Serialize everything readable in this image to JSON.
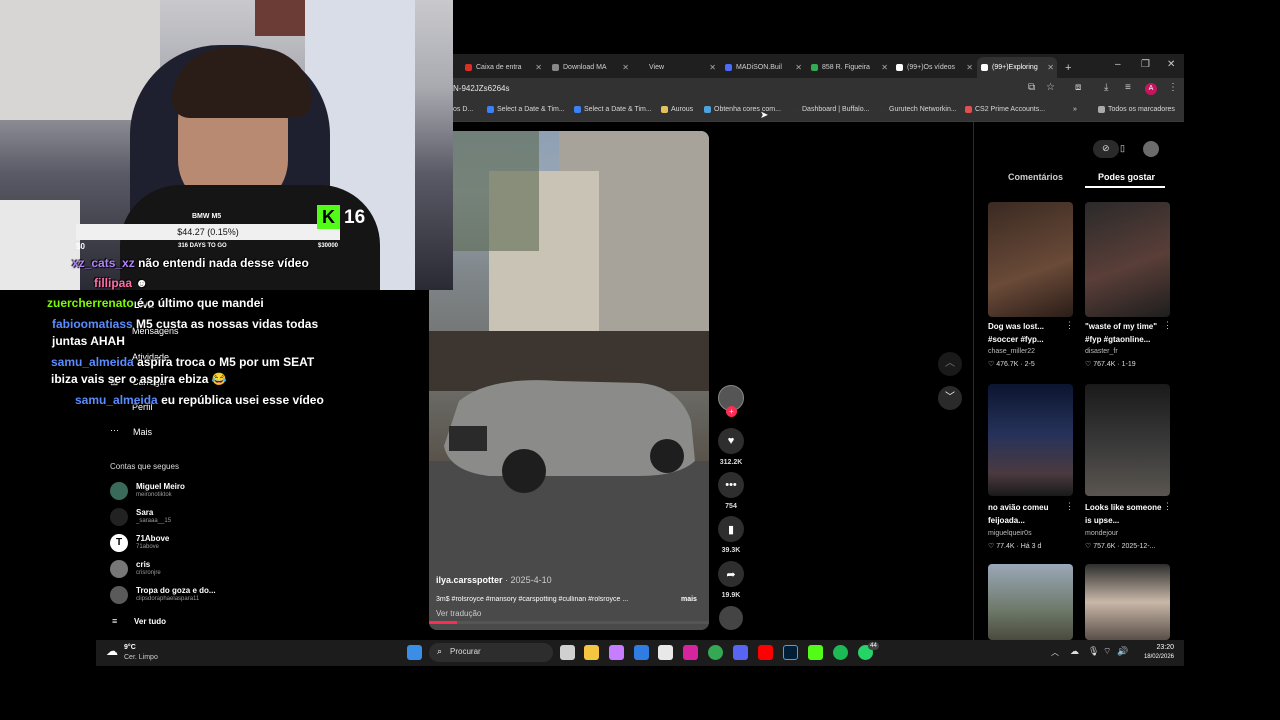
{
  "browser": {
    "tabs": [
      {
        "label": "Caixa de entra",
        "color": "#d93025"
      },
      {
        "label": "Download MA",
        "color": "#888888"
      },
      {
        "label": "View",
        "color": "#888888"
      },
      {
        "label": "MADiSON.Buil",
        "color": "#4a6cf7"
      },
      {
        "label": "858 R. Figueira",
        "color": "#34a853"
      },
      {
        "label": "(99+)Os vídeos",
        "color": "#ffffff"
      },
      {
        "label": "(99+)Exploring",
        "color": "#ffffff"
      }
    ],
    "url": "N-942JZs6264s",
    "bookmarks": [
      {
        "label": "os D...",
        "color": "#888888"
      },
      {
        "label": "Select a Date & Tim...",
        "color": "#3b82f6"
      },
      {
        "label": "Select a Date & Tim...",
        "color": "#3b82f6"
      },
      {
        "label": "Aurous",
        "color": "#e0c060"
      },
      {
        "label": "Obtenha cores com...",
        "color": "#4aa3df"
      },
      {
        "label": "Dashboard | Buffalo...",
        "color": "#333333"
      },
      {
        "label": "Gurutech Networkin...",
        "color": "#333333"
      },
      {
        "label": "CS2 Prime Accounts...",
        "color": "#e05050"
      }
    ],
    "all_bookmarks": "Todos os marcadores"
  },
  "right_panel": {
    "tabs": [
      "Comentários",
      "Podes gostar"
    ],
    "active_tab": "Podes gostar",
    "cards": [
      {
        "title": "Dog was lost... #soccer #fyp...",
        "user": "chase_miller22",
        "meta": "♡ 476.7K · 2-5"
      },
      {
        "title": "\"waste of my time\" #fyp #gtaonline...",
        "user": "disaster_fr",
        "meta": "♡ 767.4K · 1-19"
      },
      {
        "title": "no avião comeu feijoada...",
        "user": "miguelqueir0s",
        "meta": "♡ 77.4K · Há 3 d"
      },
      {
        "title": "Looks like someone is upse...",
        "user": "mondejour",
        "meta": "♡ 757.6K · 2025-12-..."
      }
    ]
  },
  "video": {
    "author": "ilya.carsspotter",
    "date": "2025-4-10",
    "caption": "3m$ #rolsroyce #mansory #carspotting #cullinan #rolsroyce ...",
    "more": "mais",
    "translate": "Ver tradução",
    "likes": "312.2K",
    "comments": "754",
    "saves": "39.3K",
    "shares": "19.9K"
  },
  "sidebar": {
    "items": [
      "LIVE",
      "Mensagens",
      "Atividade",
      "Carregar",
      "Perfil",
      "Mais"
    ],
    "following_title": "Contas que segues",
    "accounts": [
      {
        "name": "Miguel Meiro",
        "handle": "meironotiktok"
      },
      {
        "name": "Sara",
        "handle": "_saraaa__15"
      },
      {
        "name": "71Above",
        "handle": "71above"
      },
      {
        "name": "cris",
        "handle": "crisronjre"
      },
      {
        "name": "Tropa do goza e do...",
        "handle": "clipsdoraphaelaspara11"
      }
    ],
    "see_all": "Ver tudo"
  },
  "overlay": {
    "stock_name": "BMW M5",
    "price": "$44.27 (0.15%)",
    "min": "$0",
    "days": "316 DAYS TO GO",
    "max": "$30000",
    "kick_count": "16"
  },
  "chat": [
    {
      "user": "xz_cats_xz",
      "msg": "não entendi nada desse vídeo",
      "color": "#b084f5"
    },
    {
      "user": "fillipaa",
      "msg": "",
      "color": "#ff6fa8"
    },
    {
      "user": "zuercherrenato",
      "msg": "é o último que mandei",
      "color": "#7cfc00"
    },
    {
      "user": "fabioomatiass",
      "msg": "M5 custa as nossas vidas todas juntas AHAH",
      "color": "#5b8cff"
    },
    {
      "user": "samu_almeida",
      "msg": "aspira troca o M5 por um SEAT ibiza vais ser o aspira ebiza 😂",
      "color": "#5b8cff"
    },
    {
      "user": "samu_almeida",
      "msg": "eu república usei esse vídeo",
      "color": "#5b8cff"
    }
  ],
  "taskbar": {
    "weather_temp": "9°C",
    "weather_desc": "Cer. Limpo",
    "search_placeholder": "Procurar",
    "time": "23:20",
    "date": "18/02/2026",
    "badge": "44"
  }
}
